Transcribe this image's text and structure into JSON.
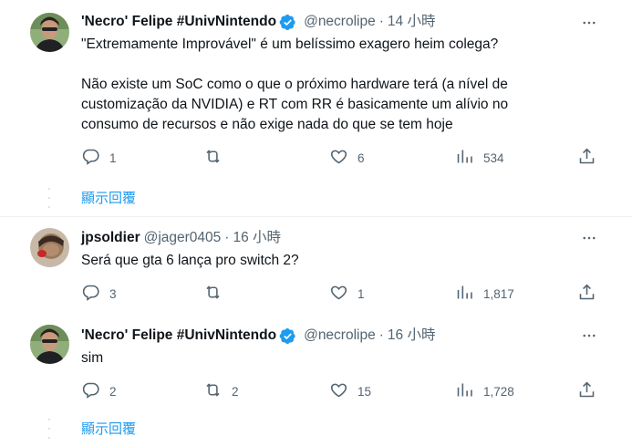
{
  "tweets": [
    {
      "author": "'Necro' Felipe #UnivNintendo",
      "handle": "@necrolipe",
      "separator": "·",
      "time": "14 小時",
      "paragraphs": [
        "\"Extremamente Improvável\" é um belíssimo exagero heim colega?",
        "Não existe um SoC como o que o próximo hardware terá (a nível de\ncustomização da NVIDIA) e RT com RR é basicamente um alívio no\nconsumo de recursos e não exige nada do que se tem hoje"
      ],
      "replies": "1",
      "retweets": "",
      "likes": "6",
      "views": "534"
    },
    {
      "author": "jpsoldier",
      "handle": "@jager0405",
      "separator": "·",
      "time": "16 小時",
      "paragraphs": [
        "Será que gta 6 lança pro switch 2?"
      ],
      "replies": "3",
      "retweets": "",
      "likes": "1",
      "views": "1,817"
    },
    {
      "author": "'Necro' Felipe #UnivNintendo",
      "handle": "@necrolipe",
      "separator": "·",
      "time": "16 小時",
      "paragraphs": [
        "sim"
      ],
      "replies": "2",
      "retweets": "2",
      "likes": "15",
      "views": "1,728"
    }
  ],
  "show_replies_label": "顯示回覆",
  "icons": {
    "more": "more-horizontal-icon",
    "reply": "reply-bubble-icon",
    "retweet": "retweet-icon",
    "like": "heart-icon",
    "views": "bar-chart-icon",
    "share": "share-upload-icon",
    "verified": "verified-badge-icon"
  },
  "colors": {
    "text": "#0f1419",
    "secondary": "#536471",
    "link": "#1d9bf0",
    "verified": "#1d9bf0",
    "divider": "#eff3f4"
  }
}
